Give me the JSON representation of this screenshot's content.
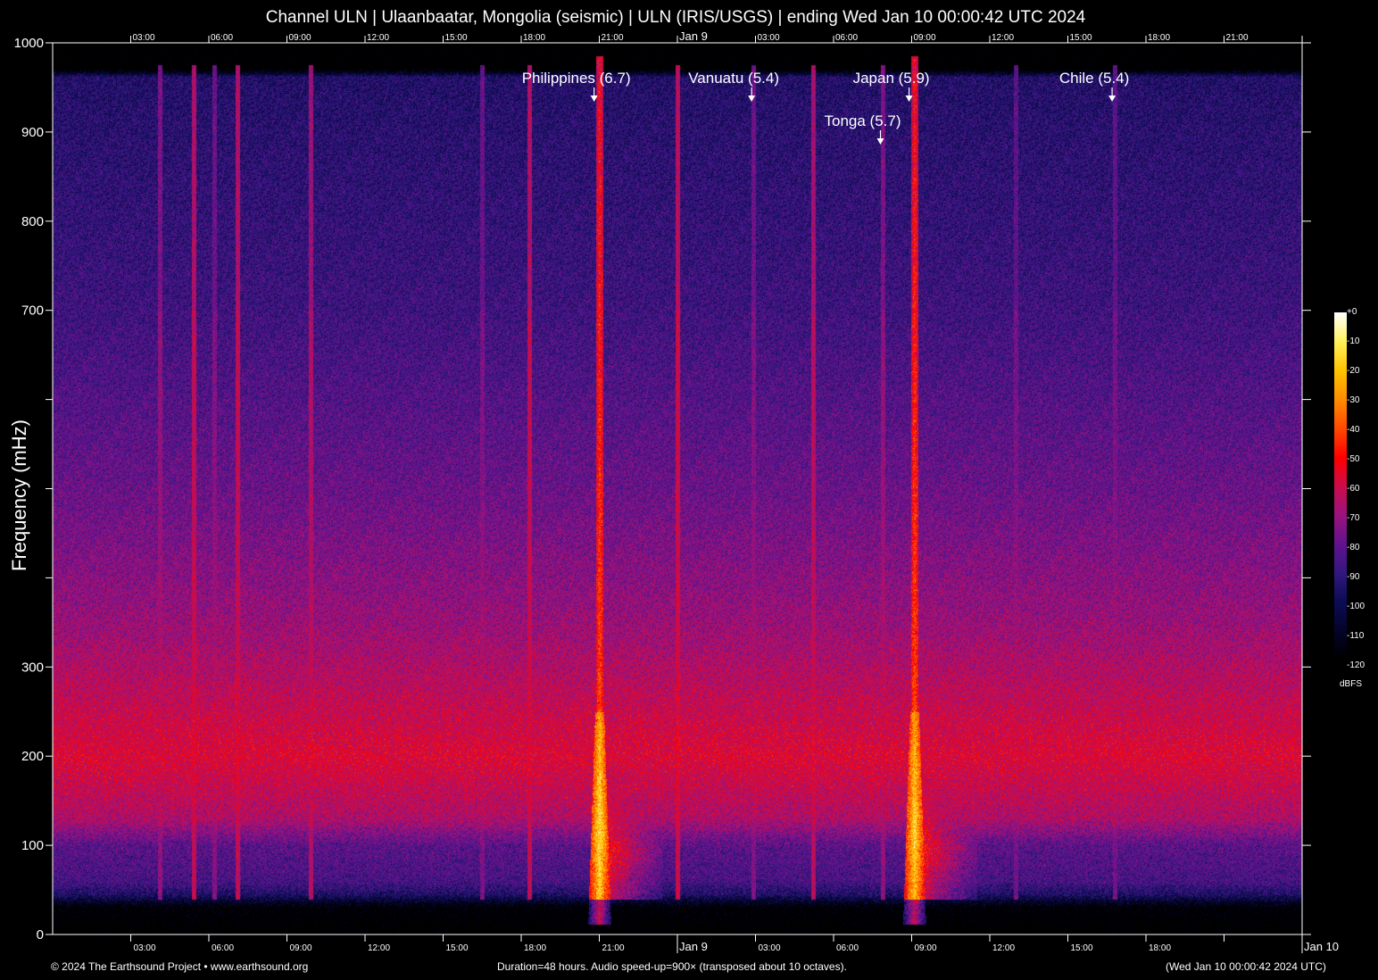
{
  "chart_data": {
    "type": "heatmap",
    "title": "Channel ULN | Ulaanbaatar, Mongolia (seismic) | ULN (IRIS/USGS) | ending Wed Jan 10 00:00:42 UTC 2024",
    "xlabel": "",
    "ylabel": "Frequency (mHz)",
    "x_units": "hours since Jan 8 00:00 UTC",
    "xlim": [
      0,
      48
    ],
    "ylim": [
      0,
      1000
    ],
    "y_ticks": [
      0,
      100,
      200,
      300,
      400,
      500,
      600,
      700,
      800,
      900,
      1000
    ],
    "y_tick_labels": [
      "0",
      "100",
      "200",
      "300",
      "",
      "",
      "",
      "700",
      "800",
      "900",
      "1000"
    ],
    "x_ticks_top": [
      {
        "hour": 3,
        "label": "03:00"
      },
      {
        "hour": 6,
        "label": "06:00"
      },
      {
        "hour": 9,
        "label": "09:00"
      },
      {
        "hour": 12,
        "label": "12:00"
      },
      {
        "hour": 15,
        "label": "15:00"
      },
      {
        "hour": 18,
        "label": "18:00"
      },
      {
        "hour": 21,
        "label": "21:00"
      },
      {
        "hour": 24,
        "label": "Jan  9"
      },
      {
        "hour": 27,
        "label": "03:00"
      },
      {
        "hour": 30,
        "label": "06:00"
      },
      {
        "hour": 33,
        "label": "09:00"
      },
      {
        "hour": 36,
        "label": "12:00"
      },
      {
        "hour": 39,
        "label": "15:00"
      },
      {
        "hour": 42,
        "label": "18:00"
      },
      {
        "hour": 45,
        "label": "21:00"
      },
      {
        "hour": 48,
        "label": ""
      }
    ],
    "x_ticks_bottom": [
      {
        "hour": 3,
        "label": "03:00"
      },
      {
        "hour": 6,
        "label": "06:00"
      },
      {
        "hour": 9,
        "label": "09:00"
      },
      {
        "hour": 12,
        "label": "12:00"
      },
      {
        "hour": 15,
        "label": "15:00"
      },
      {
        "hour": 18,
        "label": "18:00"
      },
      {
        "hour": 21,
        "label": "21:00"
      },
      {
        "hour": 24,
        "label": "Jan  9"
      },
      {
        "hour": 27,
        "label": "03:00"
      },
      {
        "hour": 30,
        "label": "06:00"
      },
      {
        "hour": 33,
        "label": "09:00"
      },
      {
        "hour": 36,
        "label": "12:00"
      },
      {
        "hour": 39,
        "label": "15:00"
      },
      {
        "hour": 42,
        "label": "18:00"
      },
      {
        "hour": 45,
        "label": ""
      },
      {
        "hour": 48,
        "label": "Jan 10"
      }
    ],
    "colorbar": {
      "label": "dBFS",
      "range": [
        -120,
        0
      ],
      "tick_labels": [
        "+0",
        "-10",
        "-20",
        "-30",
        "-40",
        "-50",
        "-60",
        "-70",
        "-80",
        "-90",
        "-100",
        "-110",
        "-120"
      ],
      "stops": [
        {
          "db": -120,
          "color": "#000000"
        },
        {
          "db": -110,
          "color": "#04042a"
        },
        {
          "db": -100,
          "color": "#0c0c55"
        },
        {
          "db": -90,
          "color": "#33187f"
        },
        {
          "db": -80,
          "color": "#62128f"
        },
        {
          "db": -70,
          "color": "#9a1480"
        },
        {
          "db": -60,
          "color": "#cc0d4c"
        },
        {
          "db": -50,
          "color": "#ff0000"
        },
        {
          "db": -40,
          "color": "#ff4a00"
        },
        {
          "db": -30,
          "color": "#ff8c00"
        },
        {
          "db": -20,
          "color": "#ffc400"
        },
        {
          "db": -10,
          "color": "#fff25a"
        },
        {
          "db": 0,
          "color": "#ffffff"
        }
      ]
    },
    "background_profile_db": [
      [
        0,
        -128
      ],
      [
        30,
        -122
      ],
      [
        45,
        -96
      ],
      [
        60,
        -86
      ],
      [
        100,
        -82
      ],
      [
        130,
        -66
      ],
      [
        200,
        -57
      ],
      [
        260,
        -62
      ],
      [
        350,
        -70
      ],
      [
        500,
        -79
      ],
      [
        700,
        -88
      ],
      [
        900,
        -93
      ],
      [
        962,
        -95
      ],
      [
        972,
        -128
      ],
      [
        1000,
        -128
      ]
    ],
    "events": [
      {
        "label": "Philippines (6.7)",
        "arrow_hour": 20.8,
        "signal_hour": 21.0,
        "row": 0,
        "peak_db": -12
      },
      {
        "label": "Vanuatu (5.4)",
        "arrow_hour": 26.85,
        "signal_hour": 26.9,
        "row": 0,
        "peak_db": -75
      },
      {
        "label": "Tonga (5.7)",
        "arrow_hour": 31.8,
        "signal_hour": 31.9,
        "row": 1,
        "peak_db": -72
      },
      {
        "label": "Japan (5.9)",
        "arrow_hour": 32.9,
        "signal_hour": 33.1,
        "row": 0,
        "peak_db": -14
      },
      {
        "label": "Chile (5.4)",
        "arrow_hour": 40.7,
        "signal_hour": 40.8,
        "row": 0,
        "peak_db": -78
      }
    ],
    "streaks": [
      {
        "hour": 4.1,
        "peak_db": -72
      },
      {
        "hour": 5.4,
        "peak_db": -62
      },
      {
        "hour": 6.2,
        "peak_db": -75
      },
      {
        "hour": 7.1,
        "peak_db": -62
      },
      {
        "hour": 9.9,
        "peak_db": -66
      },
      {
        "hour": 16.5,
        "peak_db": -76
      },
      {
        "hour": 18.3,
        "peak_db": -62
      },
      {
        "hour": 21.0,
        "peak_db": -12
      },
      {
        "hour": 24.0,
        "peak_db": -60
      },
      {
        "hour": 26.9,
        "peak_db": -75
      },
      {
        "hour": 29.2,
        "peak_db": -64
      },
      {
        "hour": 31.9,
        "peak_db": -72
      },
      {
        "hour": 33.1,
        "peak_db": -14
      },
      {
        "hour": 37.0,
        "peak_db": -78
      },
      {
        "hour": 40.8,
        "peak_db": -78
      }
    ]
  },
  "footer": {
    "copyright": "© 2024 The Earthsound Project • www.earthsound.org",
    "duration": "Duration=48 hours. Audio speed-up=900× (transposed about 10 octaves).",
    "timestamp": "(Wed Jan 10 00:00:42 2024 UTC)"
  }
}
